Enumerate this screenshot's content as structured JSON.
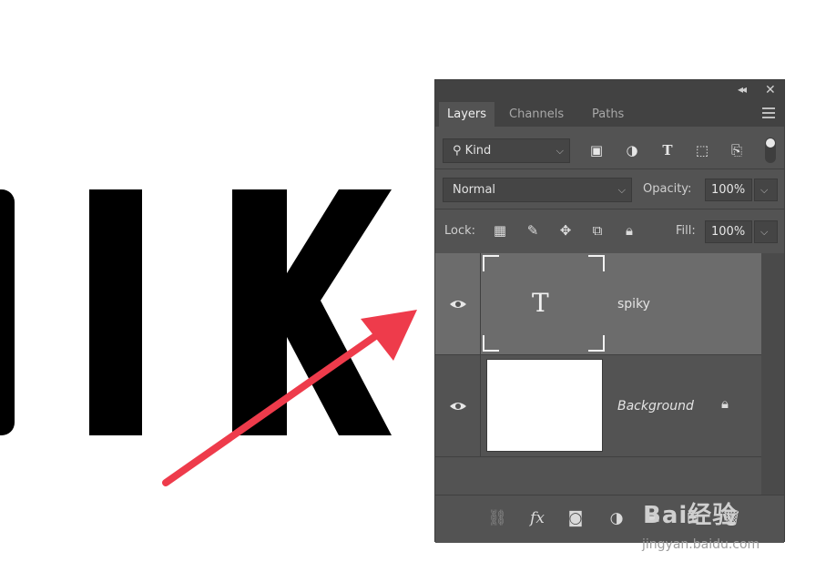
{
  "panel": {
    "tabs": [
      {
        "label": "Layers",
        "active": true
      },
      {
        "label": "Channels",
        "active": false
      },
      {
        "label": "Paths",
        "active": false
      }
    ]
  },
  "filter": {
    "kind_label": "Kind"
  },
  "blend": {
    "mode": "Normal",
    "opacity_label": "Opacity:",
    "opacity_value": "100%"
  },
  "lock": {
    "label": "Lock:",
    "fill_label": "Fill:",
    "fill_value": "100%"
  },
  "layers": [
    {
      "name": "spiky",
      "type": "text",
      "thumb_glyph": "T",
      "selected": true
    },
    {
      "name": "Background",
      "type": "background",
      "locked": true
    }
  ],
  "canvas": {
    "letters": "PIK"
  },
  "watermark": {
    "main": "Bai经验",
    "sub": "jingyan.baidu.com"
  },
  "colors": {
    "arrow": "#ee3b4b",
    "panel": "#535353",
    "selected_row": "#6c6c6c"
  }
}
